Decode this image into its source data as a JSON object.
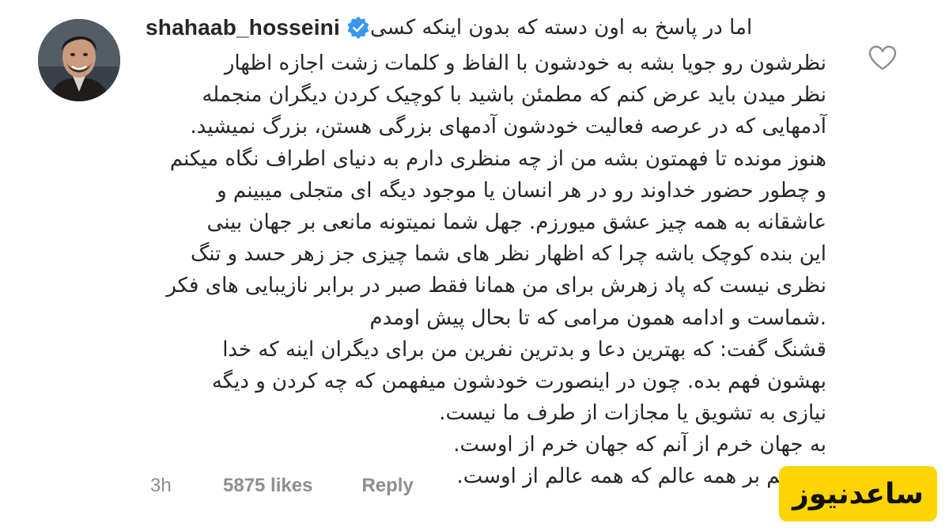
{
  "comment": {
    "username": "shahaab_hosseini",
    "verified_icon": "verified-badge-icon",
    "first_line": "اما در پاسخ به اون دسته که بدون اینکه کسی",
    "lines": [
      "نظرشون رو جویا بشه به خودشون با الفاظ و کلمات زشت اجازه اظهار",
      "نظر میدن باید عرض کنم که مطمئن باشید با کوچیک کردن دیگران منجمله",
      "آدمهایی که در عرصه فعالیت خودشون آدمهای بزرگی هستن، بزرگ نمیشید.",
      "هنوز مونده تا فهمتون بشه من از چه منظری دارم به دنیای اطراف نگاه میکنم",
      "و چطور حضور خداوند رو در هر انسان یا موجود دیگه ای متجلی میبینم و",
      "عاشقانه به همه چیز عشق میورزم. جهل شما  نمیتونه مانعی بر جهان بینی",
      "این بنده کوچک باشه چرا که اظهار نظر های شما چیزی جز زهر حسد و تنگ",
      "نظری نیست که پاد زهرش برای من همانا فقط صبر در برابر نازیبایی های فکر",
      ".شماست و ادامه همون مرامی که تا بحال پیش اومدم",
      "قشنگ گفت: که بهترین دعا و بدترین نفرین من برای دیگران اینه که خدا",
      "بهشون فهم بده. چون در اینصورت خودشون میفهمن که چه کردن و دیگه",
      "نیازی به تشویق یا مجازات از طرف ما نیست.",
      "به جهان خرم از آنم که جهان خرم از اوست.",
      "عاشقم بر همه عالم که همه عالم از اوست."
    ]
  },
  "footer": {
    "time": "3h",
    "likes": "5875 likes",
    "reply": "Reply"
  },
  "like_icon": "heart-outline-icon",
  "watermark": {
    "text": "ساعدنیوز",
    "color": "#ffd400"
  },
  "colors": {
    "text": "#262626",
    "muted": "#8e8e8e",
    "verified": "#3897f0"
  }
}
